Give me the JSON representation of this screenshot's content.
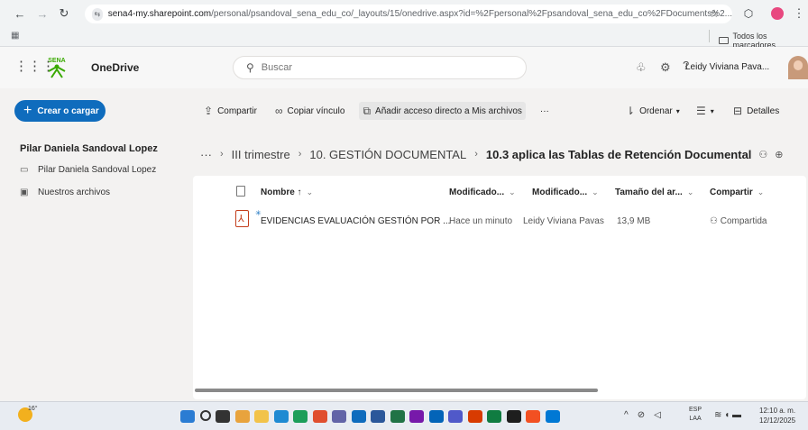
{
  "browser": {
    "url_host": "sena4-my.sharepoint.com",
    "url_path": "/personal/psandoval_sena_edu_co/_layouts/15/onedrive.aspx?id=%2Fpersonal%2Fpsandoval_sena_edu_co%2FDocuments%2...",
    "bookmarks_folder": "Todos los marcadores"
  },
  "header": {
    "app_name": "OneDrive",
    "search_placeholder": "Buscar",
    "user_name": "Leidy Viviana Pava..."
  },
  "sidebar": {
    "create_label": "Crear o cargar",
    "owner": "Pilar Daniela Sandoval Lopez",
    "items": [
      {
        "label": "Pilar Daniela Sandoval Lopez",
        "icon": "folder-icon"
      },
      {
        "label": "Nuestros archivos",
        "icon": "shared-library-icon"
      }
    ]
  },
  "commands": {
    "share": "Compartir",
    "copy_link": "Copiar vínculo",
    "add_shortcut": "Añadir acceso directo a Mis archivos",
    "more": "···",
    "sort": "Ordenar",
    "details": "Detalles"
  },
  "breadcrumb": {
    "ellipsis": "···",
    "items": [
      "III trimestre",
      "10. GESTIÓN DOCUMENTAL"
    ],
    "current": "10.3 aplica las Tablas de Retención Documental"
  },
  "columns": {
    "name": "Nombre ↑",
    "modified": "Modificado...",
    "modified_by": "Modificado...",
    "size": "Tamaño del ar...",
    "sharing": "Compartir"
  },
  "files": [
    {
      "name": "EVIDENCIAS EVALUACIÓN GESTIÓN POR ...",
      "modified": "Hace un minuto",
      "modified_by": "Leidy Viviana Pavas",
      "size": "13,9 MB",
      "sharing": "Compartida",
      "type": "pdf"
    }
  ],
  "taskbar": {
    "weather": "16°",
    "lang_top": "ESP",
    "lang_bottom": "LAA",
    "time": "12:10 a. m.",
    "date": "12/12/2025"
  },
  "colors": {
    "accent": "#0f6cbd",
    "pdf_red": "#c43e1c"
  }
}
